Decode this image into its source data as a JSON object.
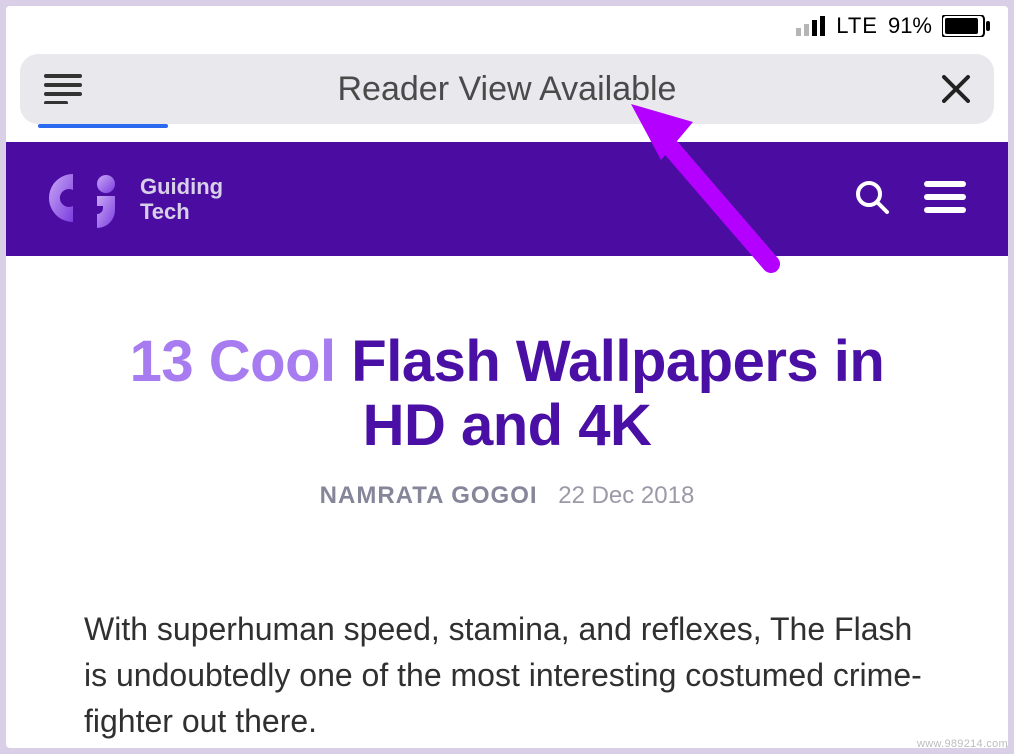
{
  "status_bar": {
    "network_label": "LTE",
    "battery_percent": "91%"
  },
  "address_bar": {
    "reader_text": "Reader View Available"
  },
  "site_header": {
    "brand_line1": "Guiding",
    "brand_line2": "Tech"
  },
  "article": {
    "title_highlight": "13 Cool",
    "title_rest_line1": " Flash Wallpapers in",
    "title_line2": "HD and 4K",
    "author": "NAMRATA GOGOI",
    "date": "22 Dec 2018",
    "body": "With superhuman speed, stamina, and reflexes, The Flash is undoubtedly one of the most interesting costumed crime-fighter out there."
  },
  "watermark": "www.989214.com"
}
